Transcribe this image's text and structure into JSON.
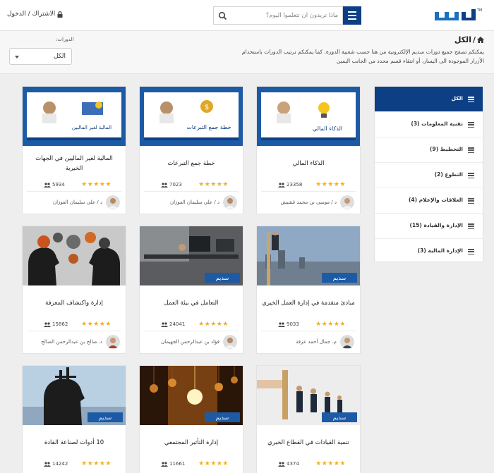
{
  "header": {
    "logo_text": "سديم",
    "search_placeholder": "ماذا تريدون ان تتعلموا اليوم؟",
    "auth_label": "الاشتراك / الدخول"
  },
  "intro": {
    "breadcrumb": "الكل",
    "description": "يمكنكم تصفح جميع دورات سديم الإلكترونية من هنا حسب شعبية الدورة. كما يمكنكم ترتيب الدورات باستخدام الأزرار الموجودة الى اليسار، أو انتقاء قسم محدد من الجانب اليمين",
    "filter_label": "الدورات:",
    "filter_value": "الكل"
  },
  "sidebar": {
    "items": [
      {
        "label": "الكل"
      },
      {
        "label": "تقنية المعلومات (3)"
      },
      {
        "label": "التخطيط (9)"
      },
      {
        "label": "التطوع (2)"
      },
      {
        "label": "العلاقات والإعلام (4)"
      },
      {
        "label": "الإدارة والقيادة (15)"
      },
      {
        "label": "الإدارة المالية (3)"
      }
    ]
  },
  "cards": [
    {
      "title": "الذكاء المالي",
      "views": "23358",
      "author": "د / موسى بن محمد قشيش",
      "rating": "★★★★★"
    },
    {
      "title": "خطة جمع التبرعات",
      "views": "7023",
      "author": "د / علي سليمان الفوزان",
      "rating": "★★★★★"
    },
    {
      "title": "المالية لغير الماليين في الجهات الخيرية",
      "views": "5934",
      "author": "د / علي سليمان الفوزان",
      "rating": "★★★★★"
    },
    {
      "title": "مبادئ متقدمة في إدارة العمل الخيري",
      "views": "9033",
      "author": "م. جمال أحمد عزقة",
      "rating": "★★★★★"
    },
    {
      "title": "التعامل في بيئة العمل",
      "views": "24041",
      "author": "فؤاد بن عبدالرحمن الجهيمان",
      "rating": "★★★★★"
    },
    {
      "title": "إدارة واكتشاف المعرفة",
      "views": "15862",
      "author": "د. صالح بن عبدالرحمن الصالح",
      "rating": "★★★★★"
    },
    {
      "title": "تنمية القيادات في القطاع الخيري",
      "views": "4374",
      "author": "",
      "rating": "★★★★★"
    },
    {
      "title": "إدارة التأثير المجتمعي",
      "views": "11661",
      "author": "",
      "rating": "★★★★★"
    },
    {
      "title": "10 أدوات لصناعة القادة",
      "views": "14242",
      "author": "",
      "rating": "★★★★★"
    }
  ],
  "thumbs": {
    "poster_a": "الذكاء المالي",
    "poster_b": "خطة جمع التبرعات",
    "poster_c": "المالية لغير الماليين",
    "brand": "سديم"
  },
  "colors": {
    "primary": "#0d3f84",
    "star": "#f2b01e",
    "poster_bg": "#1d5aa6"
  }
}
